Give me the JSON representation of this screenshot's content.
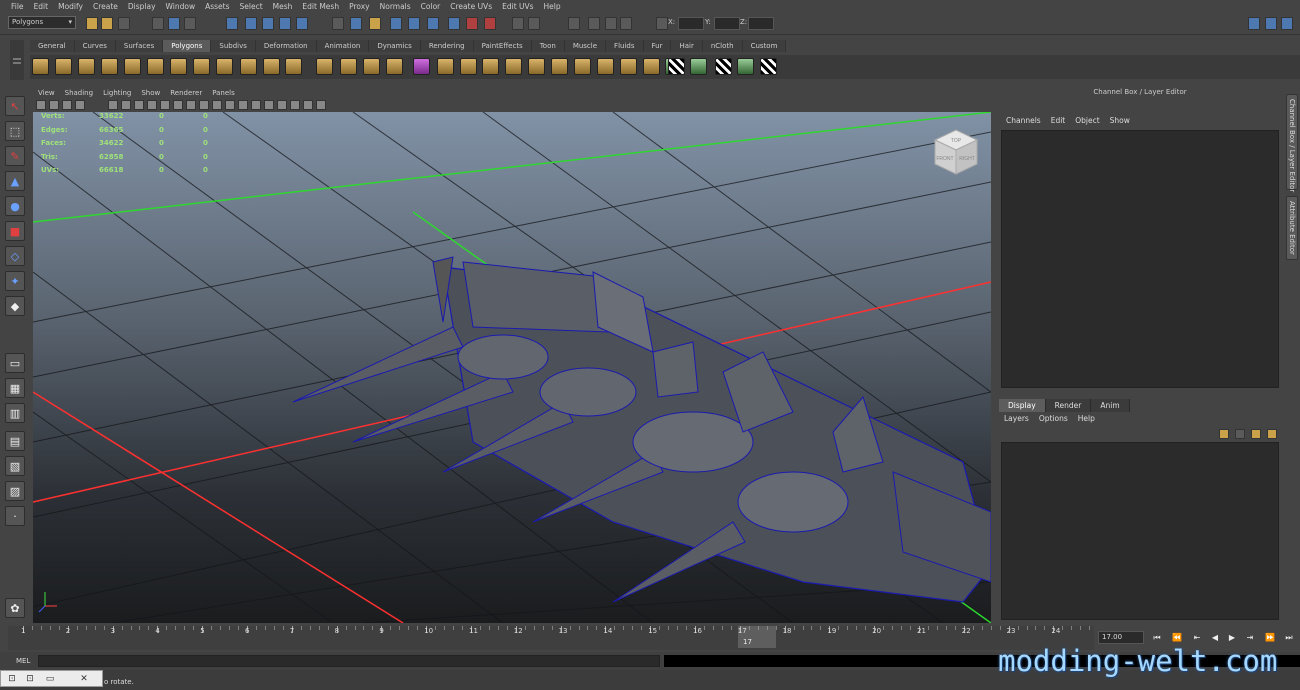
{
  "menubar": [
    "File",
    "Edit",
    "Modify",
    "Create",
    "Display",
    "Window",
    "Assets",
    "Select",
    "Mesh",
    "Edit Mesh",
    "Proxy",
    "Normals",
    "Color",
    "Create UVs",
    "Edit UVs",
    "Help"
  ],
  "status": {
    "mode": "Polygons",
    "x_label": "X:",
    "y_label": "Y:",
    "z_label": "Z:"
  },
  "shelf_tabs": [
    "General",
    "Curves",
    "Surfaces",
    "Polygons",
    "Subdivs",
    "Deformation",
    "Animation",
    "Dynamics",
    "Rendering",
    "PaintEffects",
    "Toon",
    "Muscle",
    "Fluids",
    "Fur",
    "Hair",
    "nCloth",
    "Custom"
  ],
  "shelf_active": "Polygons",
  "viewport_menu": [
    "View",
    "Shading",
    "Lighting",
    "Show",
    "Renderer",
    "Panels"
  ],
  "hud": [
    {
      "label": "Verts:",
      "v1": "33622",
      "v2": "0",
      "v3": "0"
    },
    {
      "label": "Edges:",
      "v1": "66365",
      "v2": "0",
      "v3": "0"
    },
    {
      "label": "Faces:",
      "v1": "34622",
      "v2": "0",
      "v3": "0"
    },
    {
      "label": "Tris:",
      "v1": "62858",
      "v2": "0",
      "v3": "0"
    },
    {
      "label": "UVs:",
      "v1": "66618",
      "v2": "0",
      "v3": "0"
    }
  ],
  "view_cube": {
    "top": "TOP",
    "front": "FRONT",
    "right": "RIGHT"
  },
  "channel_box": {
    "title": "Channel Box / Layer Editor",
    "menu": [
      "Channels",
      "Edit",
      "Object",
      "Show"
    ],
    "layer_tabs": [
      "Display",
      "Render",
      "Anim"
    ],
    "layer_menu": [
      "Layers",
      "Options",
      "Help"
    ]
  },
  "side_tabs": {
    "channel": "Channel Box / Layer Editor",
    "attribute": "Attribute Editor"
  },
  "timeline": {
    "ticks": [
      "1",
      "2",
      "3",
      "4",
      "5",
      "6",
      "7",
      "8",
      "9",
      "10",
      "11",
      "12",
      "13",
      "14",
      "15",
      "16",
      "17",
      "18",
      "19",
      "20",
      "21",
      "22",
      "23",
      "24"
    ],
    "current": "17",
    "frame_field": "17.00"
  },
  "mel": {
    "label": "MEL"
  },
  "help_line": "o rotate.",
  "watermark": "modding-welt.com",
  "colors": {
    "grid_x": "#ff3030",
    "grid_z": "#30d030",
    "wire": "#1a1ab0",
    "hud": "#9fe27a"
  }
}
